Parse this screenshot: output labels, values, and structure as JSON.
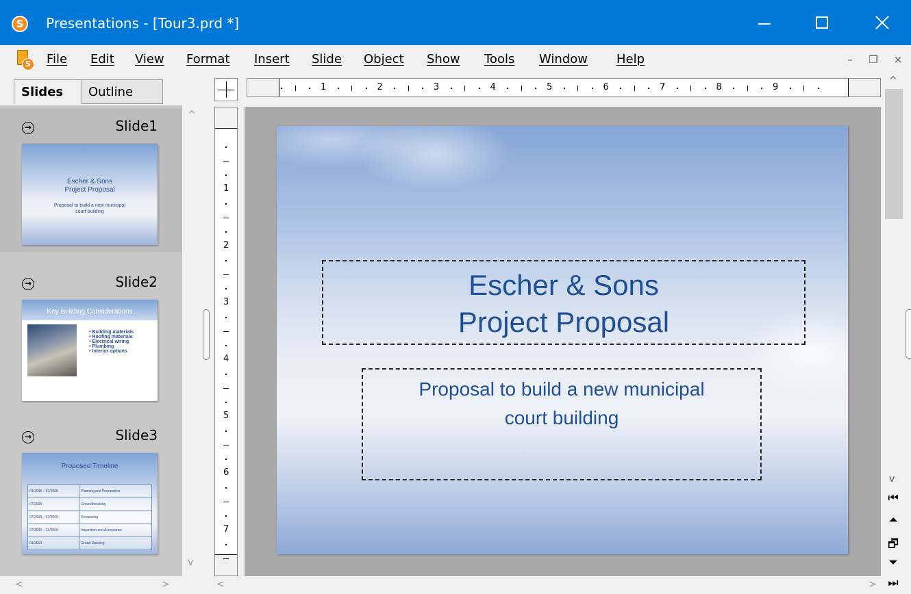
{
  "window": {
    "title": "Presentations - [Tour3.prd *]",
    "app_icon_letter": "S",
    "accent": "#0078d7"
  },
  "menu": {
    "items": [
      "File",
      "Edit",
      "View",
      "Format",
      "Insert",
      "Slide",
      "Object",
      "Show",
      "Tools",
      "Window",
      "Help"
    ],
    "mdi_min": "–",
    "mdi_restore": "❐",
    "mdi_close": "×"
  },
  "tabs": {
    "slides": "Slides",
    "outline": "Outline",
    "active": "Slides"
  },
  "slides": [
    {
      "name": "Slide1",
      "title_lines": [
        "Escher & Sons",
        "Project Proposal"
      ],
      "subtitle_lines": [
        "Proposal to build a new municipal",
        "court building"
      ]
    },
    {
      "name": "Slide2",
      "title": "Key Building Considerations",
      "bullets": [
        "Building materials",
        "Roofing materials",
        "Electrical wiring",
        "Plumbing",
        "Interior options"
      ]
    },
    {
      "name": "Slide3",
      "title": "Proposed Timeline",
      "rows": [
        [
          "01/2008 – 07/2008",
          "Planning and Preparation"
        ],
        [
          "07/2008",
          "Groundbreaking"
        ],
        [
          "07/2008 – 07/2009",
          "Processing"
        ],
        [
          "07/2009 – 12/2009",
          "Inspection and Acceptance"
        ],
        [
          "01/2010",
          "Grand Opening"
        ]
      ]
    }
  ],
  "ruler": {
    "h_numbers": [
      "1",
      "2",
      "3",
      "4",
      "5",
      "6",
      "7",
      "8",
      "9"
    ],
    "v_numbers": [
      "1",
      "2",
      "3",
      "4",
      "5",
      "6",
      "7"
    ]
  },
  "main_slide": {
    "title_lines": [
      "Escher & Sons",
      "Project Proposal"
    ],
    "subtitle_lines": [
      "Proposal to build a new municipal",
      "court building"
    ],
    "text_color": "#1f4f95"
  },
  "icons": {
    "scroll_up": "^",
    "scroll_down": "v",
    "scroll_left": "<",
    "scroll_right": ">",
    "first_slide": "⏮",
    "prev_slide": "⏶",
    "new_window": "🗗",
    "next_slide": "⏷",
    "last_slide": "⏭"
  }
}
